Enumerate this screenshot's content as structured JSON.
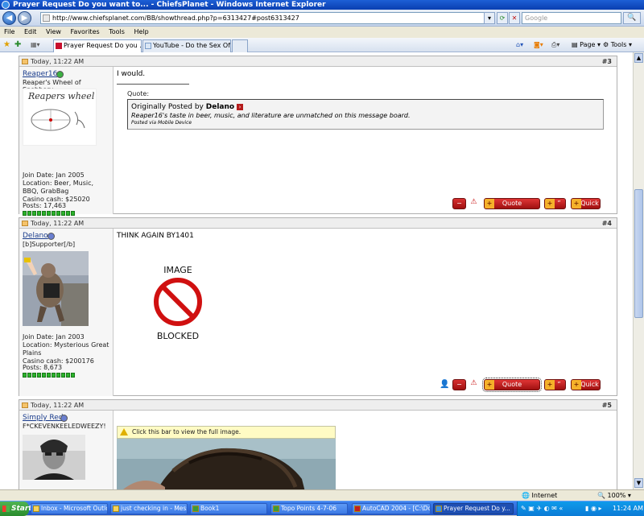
{
  "window": {
    "title": "Prayer Request Do you want to... - ChiefsPlanet - Windows Internet Explorer"
  },
  "address": {
    "url": "http://www.chiefsplanet.com/BB/showthread.php?p=6313427#post6313427",
    "search_placeholder": "Google"
  },
  "menu": [
    "File",
    "Edit",
    "View",
    "Favorites",
    "Tools",
    "Help"
  ],
  "tabs": [
    {
      "label": "Prayer Request Do you ..."
    },
    {
      "label": "YouTube - Do the Sex Offen..."
    }
  ],
  "toolbar": {
    "page_label": "Page",
    "tools_label": "Tools"
  },
  "posts": [
    {
      "time": "Today, 11:22 AM",
      "number": "#3",
      "username": "Reaper16",
      "status_color": "#3cb043",
      "user_title": "Reaper's Wheel of Snobbery",
      "avatar_text": "Reapers wheel of snobbery",
      "join_date": "Join Date: Jan 2005",
      "location": "Location: Beer, Music, BBQ, GrabBag",
      "casino": "Casino cash: $25020",
      "posts": "Posts: 17,463",
      "rep_level": 11,
      "message": "I would.",
      "quote_label": "Quote:",
      "quote_prefix": "Originally Posted by",
      "quote_author": "Delano",
      "quote_text": "Reaper16's taste in beer, music, and literature are unmatched on this message board.",
      "quote_via": "Posted via Mobile Device",
      "btn_quote": "Quote",
      "btn_multi": "”",
      "btn_quick": "Quick"
    },
    {
      "time": "Today, 11:22 AM",
      "number": "#4",
      "username": "Delano",
      "status_color": "#6a7fd0",
      "user_title": "[b]Supporter[/b]",
      "join_date": "Join Date: Jan 2003",
      "location": "Location: Mysterious Great Plains",
      "casino": "Casino cash: $200176",
      "posts": "Posts: 8,673",
      "rep_level": 11,
      "message": "THINK AGAIN BY1401",
      "image_top": "IMAGE",
      "image_bottom": "BLOCKED",
      "btn_quote": "Quote",
      "btn_multi": "”",
      "btn_quick": "Quick"
    },
    {
      "time": "Today, 11:22 AM",
      "number": "#5",
      "username": "Simply Red",
      "status_color": "#6a7fd0",
      "user_title": "F*CKEVENKEELEDWEEZY!",
      "notice": "Click this bar to view the full image."
    }
  ],
  "statusbar": {
    "zone": "Internet",
    "zoom": "100%"
  },
  "taskbar": {
    "start": "Start",
    "items": [
      "Inbox - Microsoft Outlook",
      "just checking in - Messa...",
      "Book1",
      "Topo Points 4-7-06",
      "AutoCAD 2004 - [C:\\Doc...",
      "Prayer Request Do y..."
    ],
    "clock": "11:24 AM"
  }
}
